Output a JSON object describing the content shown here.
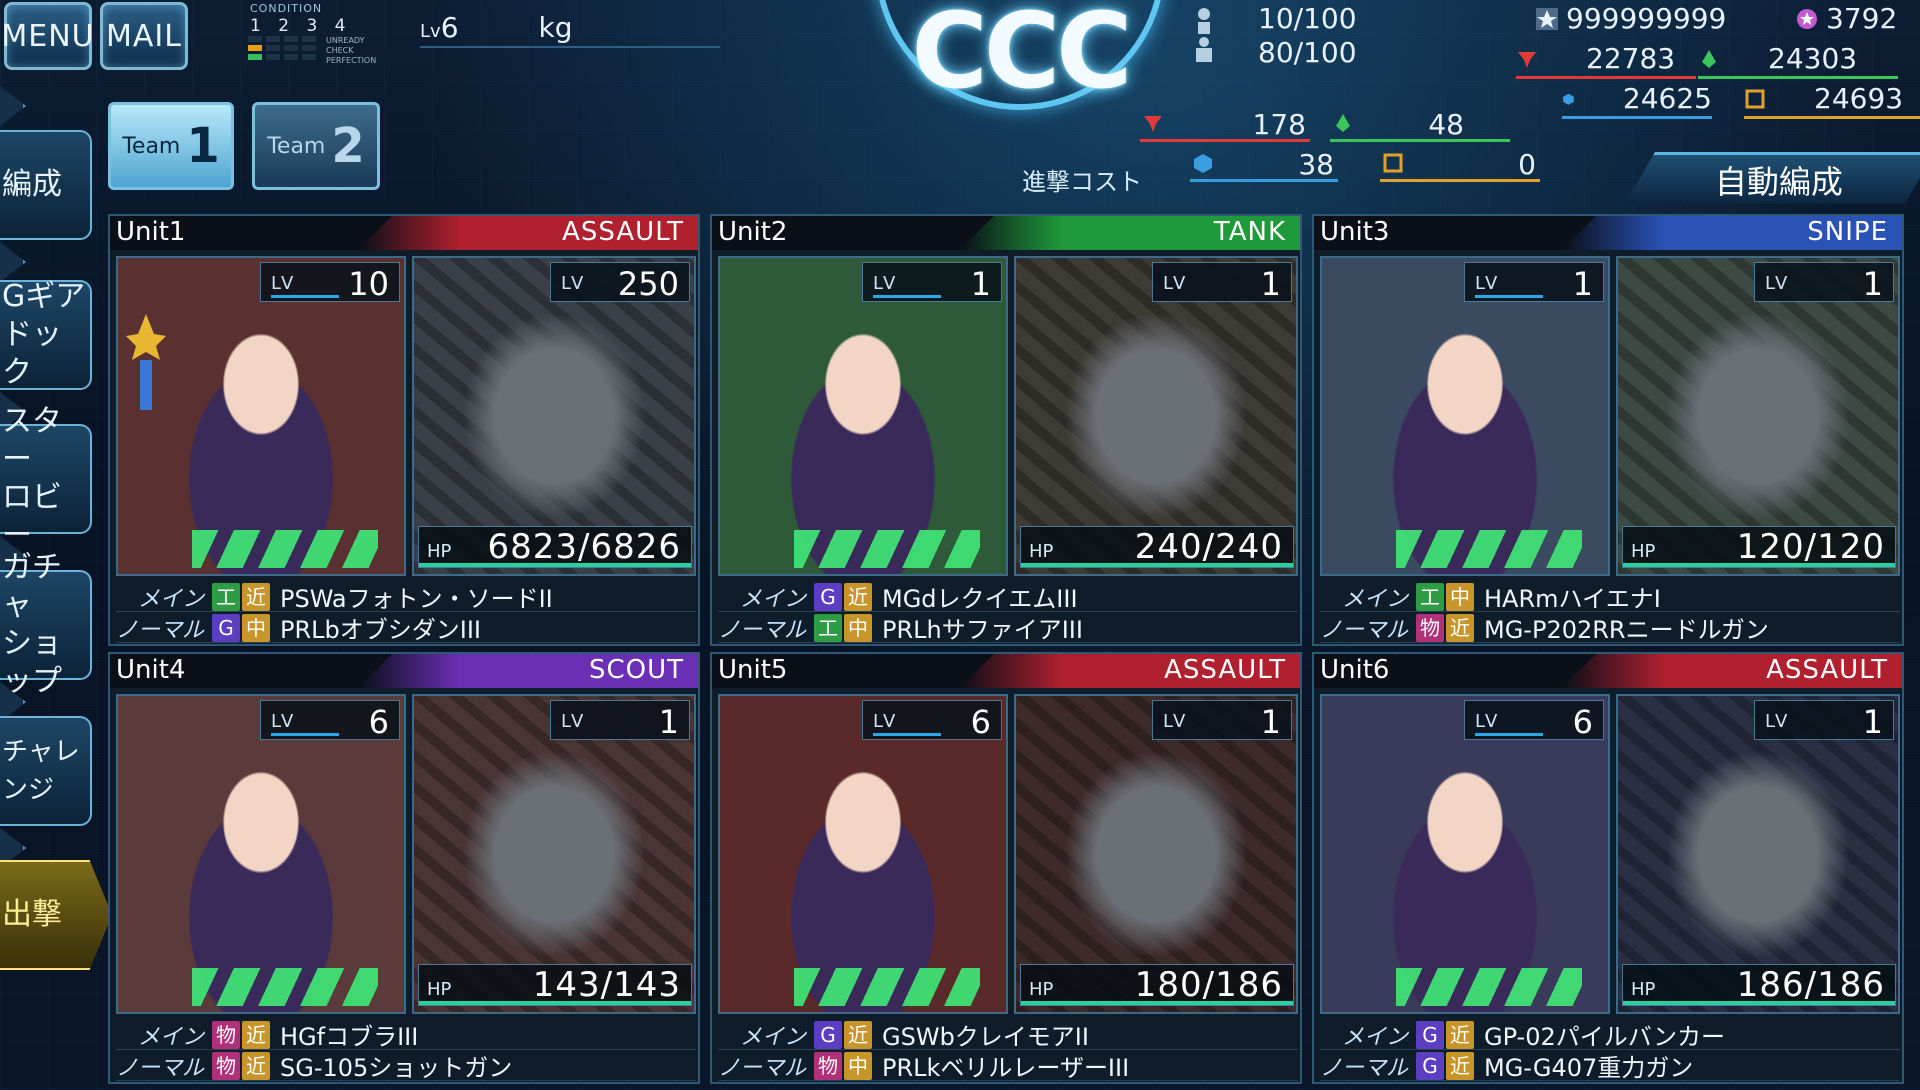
{
  "top": {
    "menu_label": "MENU",
    "mail_label": "MAIL",
    "condition_label": "CONDITION",
    "condition_numbers": "1 2 3 4",
    "condition_legend": [
      "UNREADY",
      "CHECK",
      "PERFECTION"
    ],
    "level_text": "6",
    "level_prefix": "Lv",
    "weight_text": "kg",
    "logo_text": "CCC",
    "pop_current": "10/100",
    "pop_second": "80/100"
  },
  "resources": {
    "star_value": "999999999",
    "coin_value": "3792",
    "red_value": "22783",
    "green_value": "24303",
    "blue_value": "24625",
    "gold_value": "24693"
  },
  "teams": [
    {
      "label": "Team",
      "num": "1",
      "active": true
    },
    {
      "label": "Team",
      "num": "2",
      "active": false
    }
  ],
  "cost": {
    "label": "進撃コスト",
    "red": "178",
    "green": "48",
    "blue": "38",
    "gold": "0"
  },
  "auto_button": "自動編成",
  "side_menu": [
    {
      "label": "編成"
    },
    {
      "label": "Gギア\nドック"
    },
    {
      "label": "スター\nロビー"
    },
    {
      "label": "ガチャ\nショップ"
    },
    {
      "label": "チャレンジ"
    },
    {
      "label": "出撃"
    }
  ],
  "colors": {
    "assault": "#b0202e",
    "tank": "#1f9a3a",
    "snipe": "#2a53b8",
    "scout": "#6b2fb5"
  },
  "units": [
    {
      "name": "Unit1",
      "role": "ASSAULT",
      "role_color": "#b0202e",
      "pilot_lv": "10",
      "mech_lv": "250",
      "hp": "6823/6826",
      "weapons": [
        {
          "type": "メイン",
          "t1": "工",
          "t2": "近",
          "name": "PSWaフォトン・ソードII"
        },
        {
          "type": "ノーマル",
          "t1": "G",
          "t2": "中",
          "name": "PRLbオブシダンIII"
        }
      ]
    },
    {
      "name": "Unit2",
      "role": "TANK",
      "role_color": "#1f9a3a",
      "pilot_lv": "1",
      "mech_lv": "1",
      "hp": "240/240",
      "weapons": [
        {
          "type": "メイン",
          "t1": "G",
          "t2": "近",
          "name": "MGdレクイエムIII"
        },
        {
          "type": "ノーマル",
          "t1": "工",
          "t2": "中",
          "name": "PRLhサファイアIII"
        }
      ]
    },
    {
      "name": "Unit3",
      "role": "SNIPE",
      "role_color": "#2a53b8",
      "pilot_lv": "1",
      "mech_lv": "1",
      "hp": "120/120",
      "weapons": [
        {
          "type": "メイン",
          "t1": "工",
          "t2": "中",
          "name": "HARmハイエナI"
        },
        {
          "type": "ノーマル",
          "t1": "物",
          "t2": "近",
          "name": "MG-P202RRニードルガン"
        }
      ]
    },
    {
      "name": "Unit4",
      "role": "SCOUT",
      "role_color": "#6b2fb5",
      "pilot_lv": "6",
      "mech_lv": "1",
      "hp": "143/143",
      "weapons": [
        {
          "type": "メイン",
          "t1": "物",
          "t2": "近",
          "name": "HGfコブラIII"
        },
        {
          "type": "ノーマル",
          "t1": "物",
          "t2": "近",
          "name": "SG-105ショットガン"
        }
      ]
    },
    {
      "name": "Unit5",
      "role": "ASSAULT",
      "role_color": "#b0202e",
      "pilot_lv": "6",
      "mech_lv": "1",
      "hp": "180/186",
      "weapons": [
        {
          "type": "メイン",
          "t1": "G",
          "t2": "近",
          "name": "GSWbクレイモアII"
        },
        {
          "type": "ノーマル",
          "t1": "物",
          "t2": "中",
          "name": "PRLkベリルレーザーIII"
        }
      ]
    },
    {
      "name": "Unit6",
      "role": "ASSAULT",
      "role_color": "#b0202e",
      "pilot_lv": "6",
      "mech_lv": "1",
      "hp": "186/186",
      "weapons": [
        {
          "type": "メイン",
          "t1": "G",
          "t2": "近",
          "name": "GP-02パイルバンカー"
        },
        {
          "type": "ノーマル",
          "t1": "G",
          "t2": "近",
          "name": "MG-G407重力ガン"
        }
      ]
    }
  ]
}
